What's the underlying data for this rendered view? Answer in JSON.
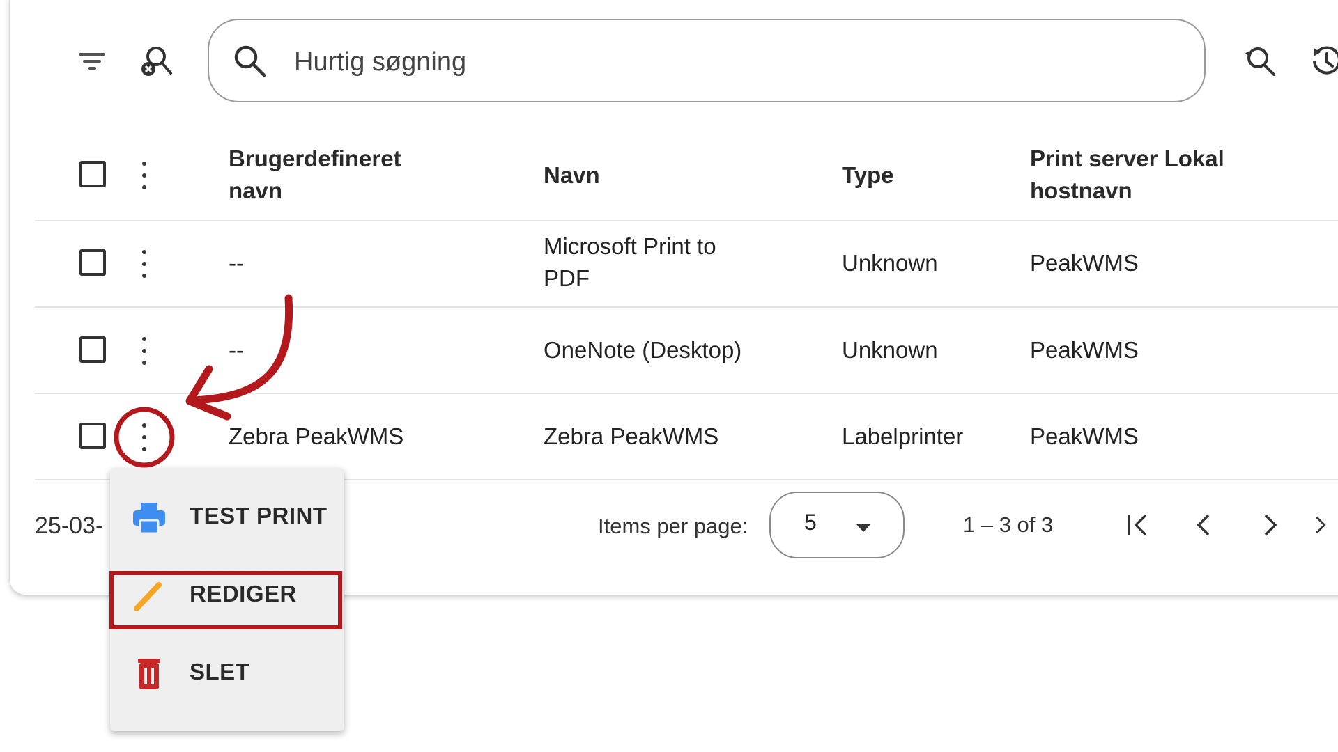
{
  "toolbar": {
    "search_placeholder": "Hurtig søgning"
  },
  "table": {
    "headers": {
      "custom_name": "Brugerdefineret navn",
      "name": "Navn",
      "type": "Type",
      "hostname": "Print server Lokal hostnavn"
    },
    "rows": [
      {
        "custom_name": "--",
        "name": "Microsoft Print to PDF",
        "type": "Unknown",
        "hostname": "PeakWMS"
      },
      {
        "custom_name": "--",
        "name": "OneNote (Desktop)",
        "type": "Unknown",
        "hostname": "PeakWMS"
      },
      {
        "custom_name": "Zebra PeakWMS",
        "name": "Zebra PeakWMS",
        "type": "Labelprinter",
        "hostname": "PeakWMS"
      }
    ]
  },
  "footer": {
    "date_fragment": "25-03-",
    "items_per_page_label": "Items per page:",
    "items_per_page_value": "5",
    "range_label": "1 – 3 of 3"
  },
  "context_menu": {
    "items": [
      {
        "label": "TEST PRINT",
        "icon": "printer-icon",
        "color": "#3d8ef0"
      },
      {
        "label": "REDIGER",
        "icon": "pencil-icon",
        "color": "#f5a623"
      },
      {
        "label": "SLET",
        "icon": "trash-icon",
        "color": "#c62828"
      }
    ]
  },
  "annotation": {
    "color": "#b3191c"
  }
}
